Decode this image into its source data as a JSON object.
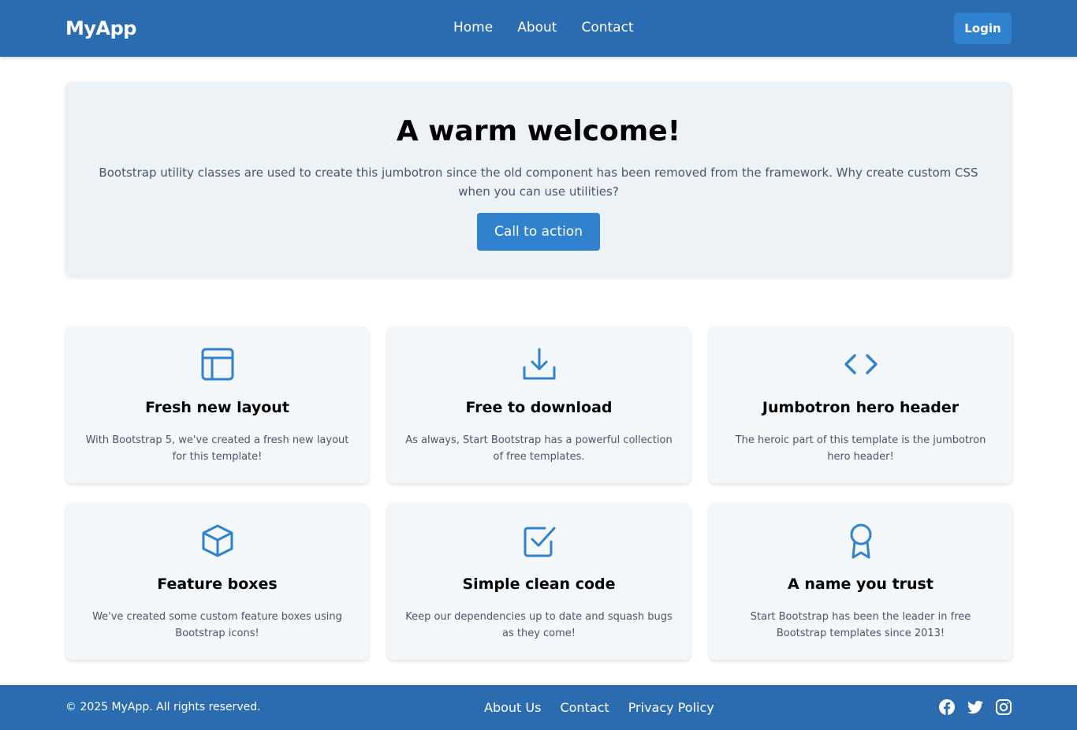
{
  "navbar": {
    "brand": "MyApp",
    "links": [
      "Home",
      "About",
      "Contact"
    ],
    "login_label": "Login"
  },
  "hero": {
    "title": "A warm welcome!",
    "text": "Bootstrap utility classes are used to create this jumbotron since the old component has been removed from the framework. Why create custom CSS when you can use utilities?",
    "cta_label": "Call to action"
  },
  "features": [
    {
      "icon": "layout-icon",
      "title": "Fresh new layout",
      "text": "With Bootstrap 5, we've created a fresh new layout for this template!"
    },
    {
      "icon": "download-icon",
      "title": "Free to download",
      "text": "As always, Start Bootstrap has a powerful collection of free templates."
    },
    {
      "icon": "code-icon",
      "title": "Jumbotron hero header",
      "text": "The heroic part of this template is the jumbotron hero header!"
    },
    {
      "icon": "box-icon",
      "title": "Feature boxes",
      "text": "We've created some custom feature boxes using Bootstrap icons!"
    },
    {
      "icon": "check-square-icon",
      "title": "Simple clean code",
      "text": "Keep our dependencies up to date and squash bugs as they come!"
    },
    {
      "icon": "award-icon",
      "title": "A name you trust",
      "text": "Start Bootstrap has been the leader in free Bootstrap templates since 2013!"
    }
  ],
  "footer": {
    "copyright": "© 2025 MyApp. All rights reserved.",
    "links": [
      "About Us",
      "Contact",
      "Privacy Policy"
    ],
    "socials": [
      "facebook-icon",
      "twitter-icon",
      "instagram-icon"
    ]
  },
  "colors": {
    "primary": "#2b6cb0",
    "button": "#3182ce",
    "jumbotron_bg": "#edf2f7",
    "card_bg": "#f4f7fa"
  }
}
